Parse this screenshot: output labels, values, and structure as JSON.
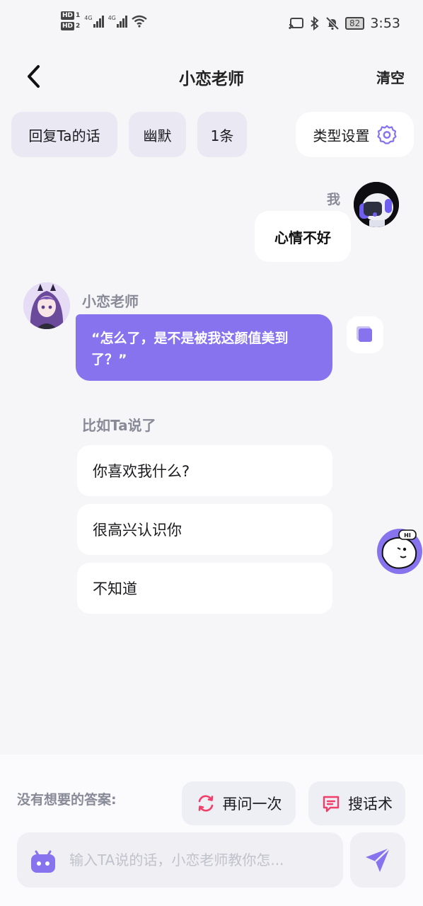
{
  "status_bar": {
    "hd1": "HD",
    "hd1_num": "1",
    "hd2": "HD",
    "hd2_num": "2",
    "net1": "4G",
    "net2": "4G",
    "battery": "82",
    "time": "3:53"
  },
  "header": {
    "title": "小恋老师",
    "clear_label": "清空"
  },
  "options": {
    "mode": "回复Ta的话",
    "style": "幽默",
    "count": "1条",
    "type_settings": "类型设置"
  },
  "chat": {
    "me_label": "我",
    "user_message": "心情不好",
    "teacher_name": "小恋老师",
    "teacher_reply": "“怎么了，是不是被我这颜值美到了？”",
    "hint_label": "比如Ta说了",
    "suggestions": [
      "你喜欢我什么?",
      "很高兴认识你",
      "不知道"
    ]
  },
  "float_bot": {
    "badge": "HI"
  },
  "bottom": {
    "no_answer": "没有想要的答案:",
    "ask_again": "再问一次",
    "search_phrases": "搜话术",
    "input_placeholder": "输入TA说的话，小恋老师教你怎..."
  },
  "colors": {
    "accent": "#8673ed",
    "refresh_icon": "#f0406a",
    "chip_bg": "#e9e8f3"
  }
}
